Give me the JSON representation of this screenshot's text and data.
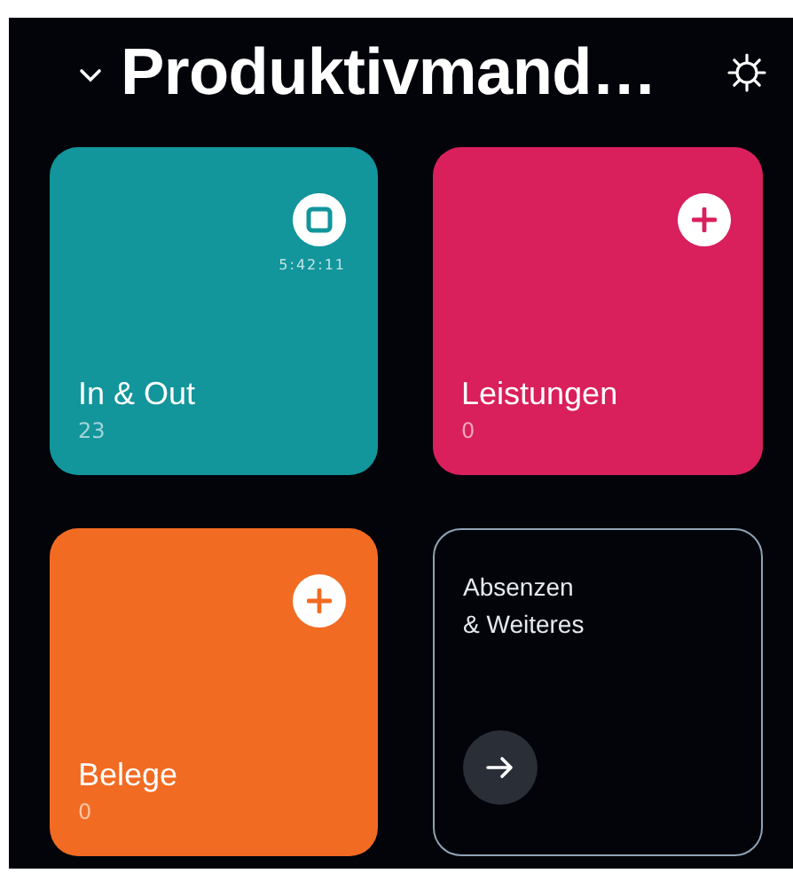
{
  "header": {
    "title": "Produktivmand…"
  },
  "tiles": [
    {
      "kind": "timer",
      "title": "In & Out",
      "count": "23",
      "timer": "5:42:11",
      "color": "#12959b"
    },
    {
      "kind": "add",
      "title": "Leistungen",
      "count": "0",
      "color": "#d91f5c"
    },
    {
      "kind": "add",
      "title": "Belege",
      "count": "0",
      "color": "#f26b22"
    },
    {
      "kind": "link",
      "title": "Absenzen\n& Weiteres"
    }
  ]
}
